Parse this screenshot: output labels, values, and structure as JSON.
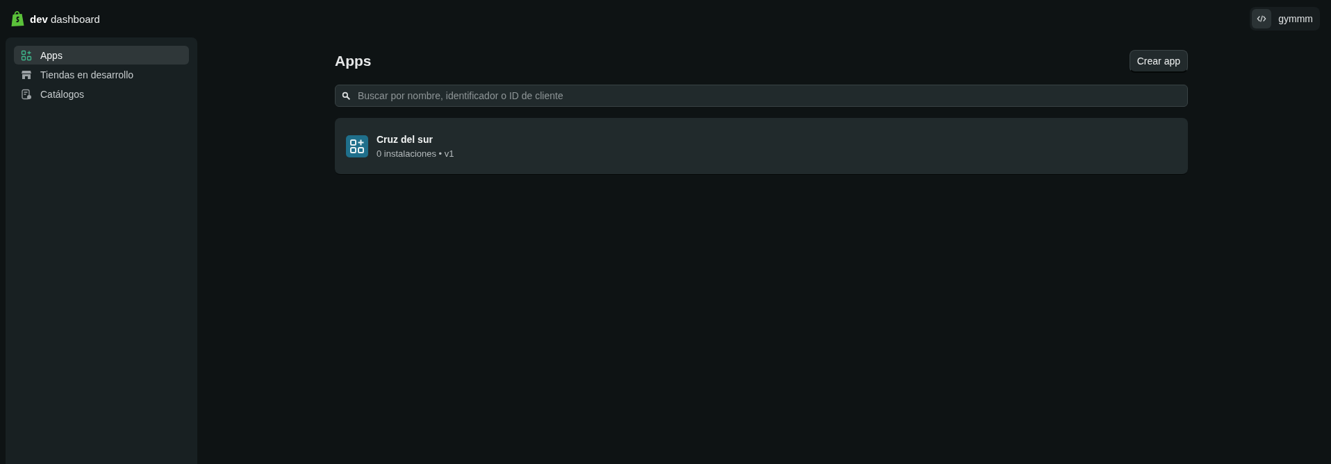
{
  "header": {
    "brand": "**dev** dashboard",
    "user": "gymmm"
  },
  "sidebar": {
    "items": [
      {
        "label": "Apps",
        "kind": "apps",
        "selected": true
      },
      {
        "label": "Tiendas en desarrollo",
        "kind": "store",
        "selected": false
      },
      {
        "label": "Catálogos",
        "kind": "catalog",
        "selected": false
      }
    ]
  },
  "page": {
    "title": "Apps",
    "button": "Crear app",
    "search": {
      "placeholder": "Buscar por nombre, identificador o ID de cliente"
    },
    "apps": [
      {
        "name": "Cruz del sur",
        "meta": "0 instalaciones • v1"
      }
    ]
  }
}
